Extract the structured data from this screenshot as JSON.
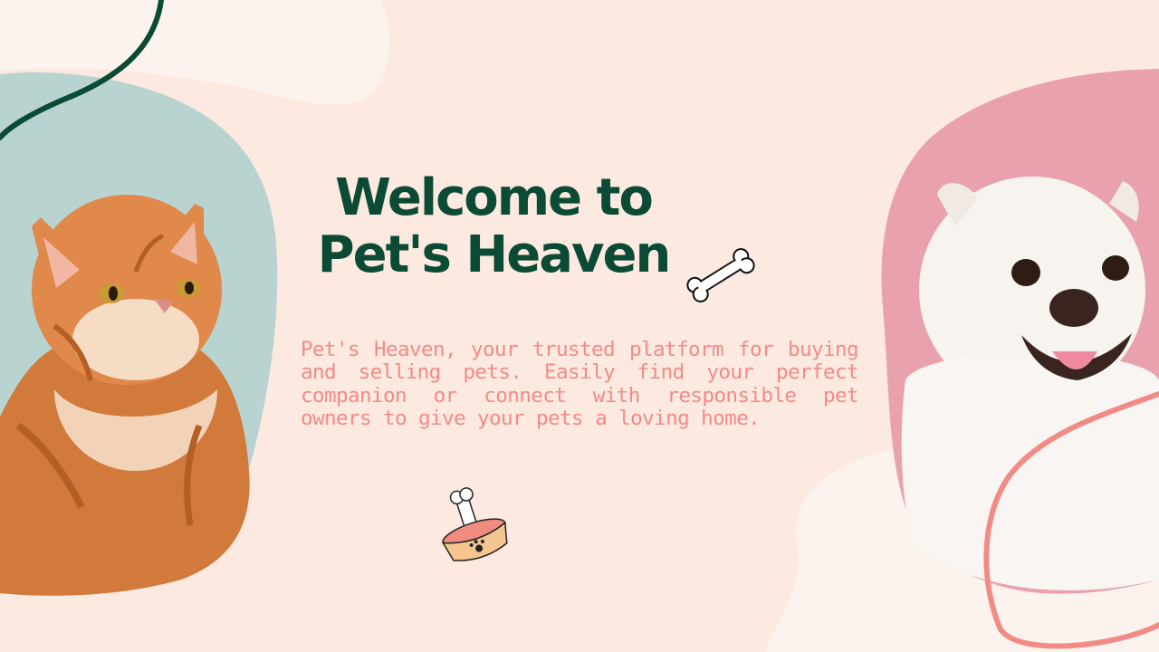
{
  "slide": {
    "title": "Welcome to Pet's Heaven",
    "description": "Pet's Heaven, your trusted platform for buying and selling pets. Easily find your perfect companion or connect with responsible pet owners to give your pets a loving home."
  },
  "colors": {
    "background": "#fce9e0",
    "title": "#0b4a35",
    "body_text": "#f28b86",
    "cat_blob": "#b8d3d0",
    "dog_blob": "#e9a2ad",
    "green_line": "#0b4a35",
    "pink_line": "#f28b86"
  },
  "icons": {
    "bone": "bone-icon",
    "bowl": "pet-bowl-icon"
  }
}
